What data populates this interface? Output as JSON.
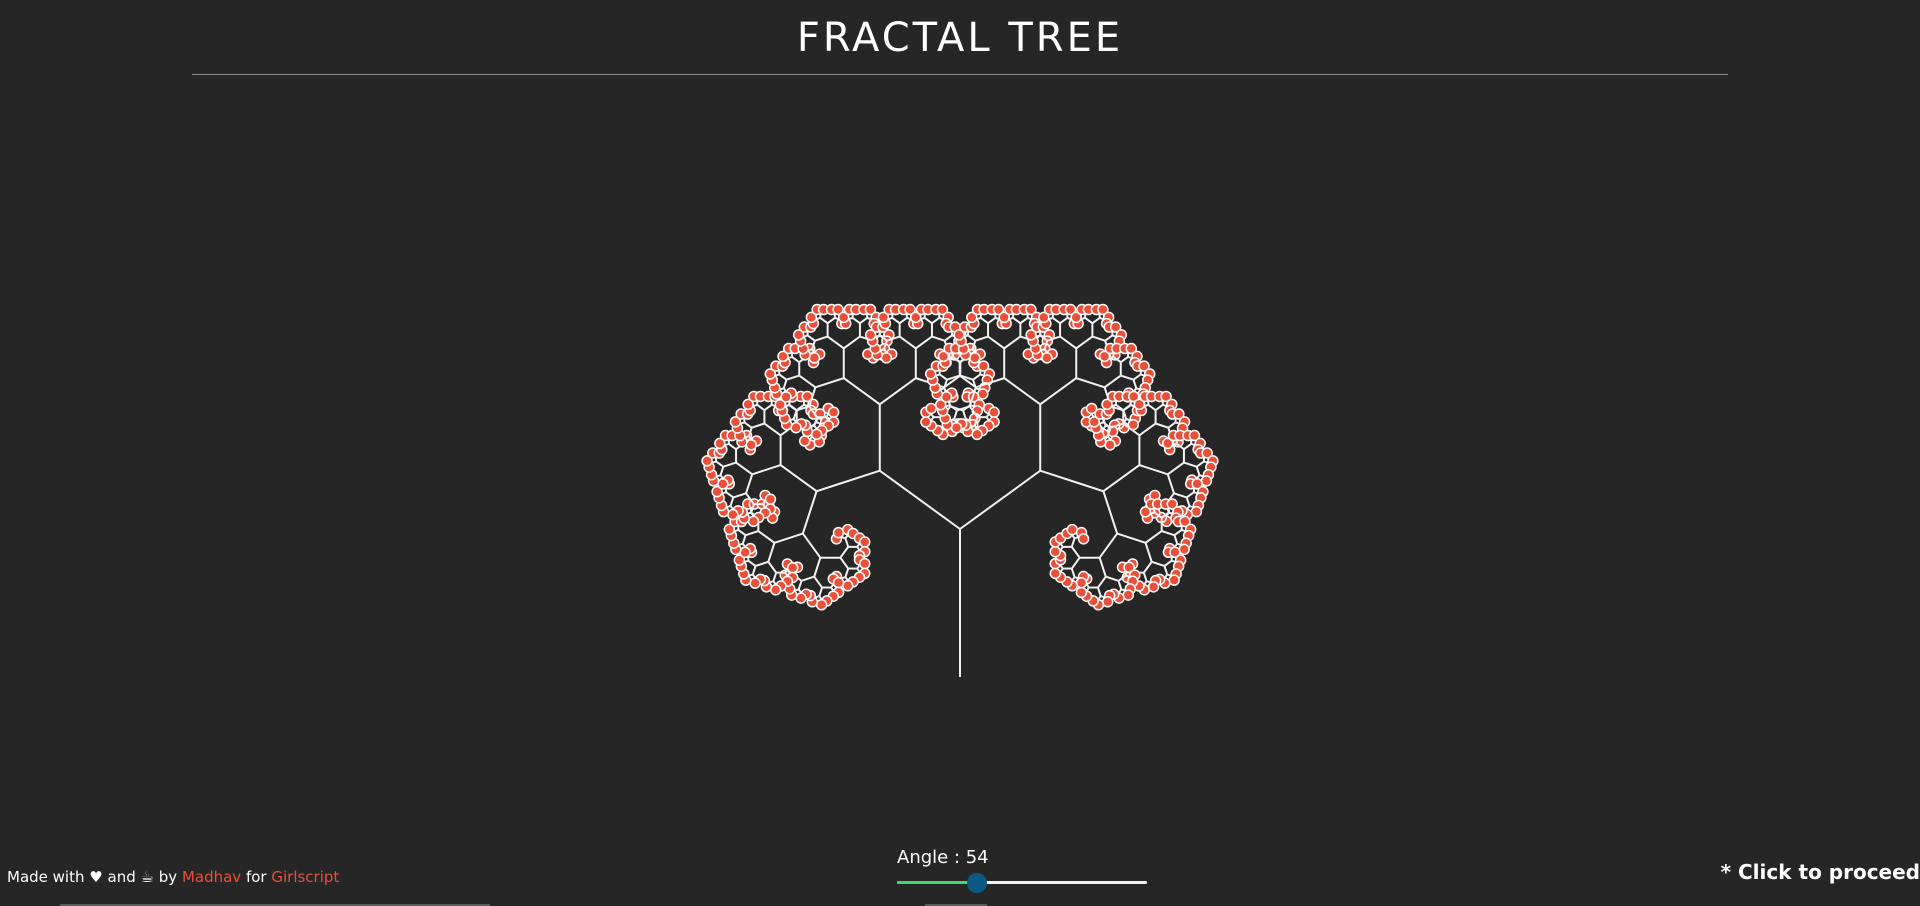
{
  "title": "FRACTAL TREE",
  "footer": {
    "made_with": "Made with",
    "heart": "♥",
    "and": "and",
    "coffee": "☕",
    "by": "by",
    "author": "Madhav",
    "for": "for",
    "org": "Girlscript"
  },
  "angle_control": {
    "label": "Angle : ",
    "value": "54",
    "angle_deg": 54,
    "slider_fraction": 0.32
  },
  "hint": "* Click to proceed",
  "colors": {
    "background": "#262626",
    "branch": "#f2f2f2",
    "leaf": "#e8503a",
    "leaf_ring": "#ffffff",
    "link": "#e8503a",
    "slider_fill": "#3ddc6a",
    "slider_thumb": "#0b5a86"
  },
  "tree": {
    "depth": 9,
    "angle_deg": 54
  }
}
